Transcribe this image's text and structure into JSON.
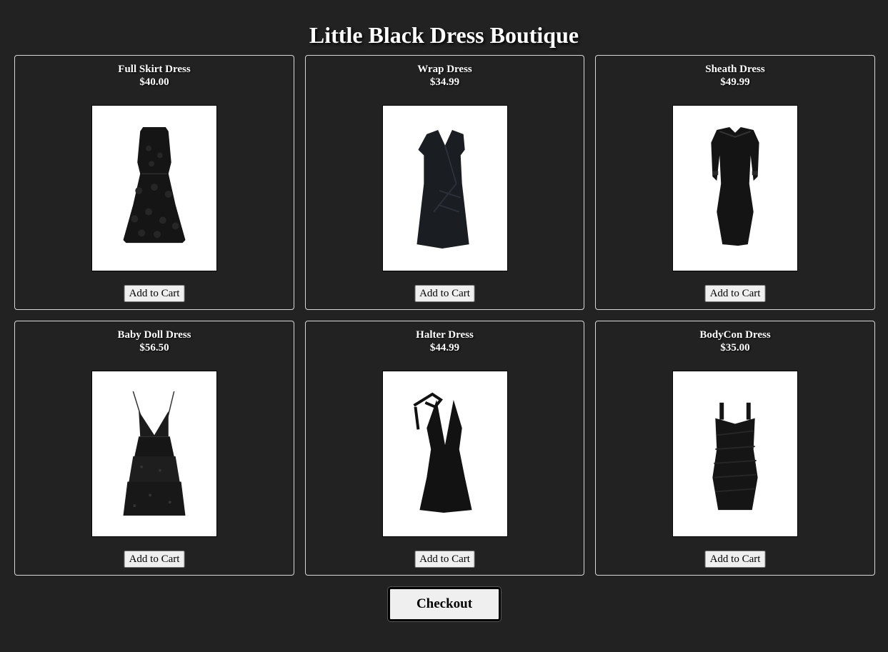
{
  "page": {
    "title": "Little Black Dress Boutique"
  },
  "products": [
    {
      "name": "Full Skirt Dress",
      "price": "$40.00",
      "button_label": "Add to Cart",
      "image": "full-skirt-dress-image"
    },
    {
      "name": "Wrap Dress",
      "price": "$34.99",
      "button_label": "Add to Cart",
      "image": "wrap-dress-image"
    },
    {
      "name": "Sheath Dress",
      "price": "$49.99",
      "button_label": "Add to Cart",
      "image": "sheath-dress-image"
    },
    {
      "name": "Baby Doll Dress",
      "price": "$56.50",
      "button_label": "Add to Cart",
      "image": "baby-doll-dress-image"
    },
    {
      "name": "Halter Dress",
      "price": "$44.99",
      "button_label": "Add to Cart",
      "image": "halter-dress-image"
    },
    {
      "name": "BodyCon Dress",
      "price": "$35.00",
      "button_label": "Add to Cart",
      "image": "bodycon-dress-image"
    }
  ],
  "checkout": {
    "label": "Checkout"
  },
  "colors": {
    "background": "#222222",
    "card_border": "#d8d8d8",
    "button_bg": "#efefef"
  }
}
